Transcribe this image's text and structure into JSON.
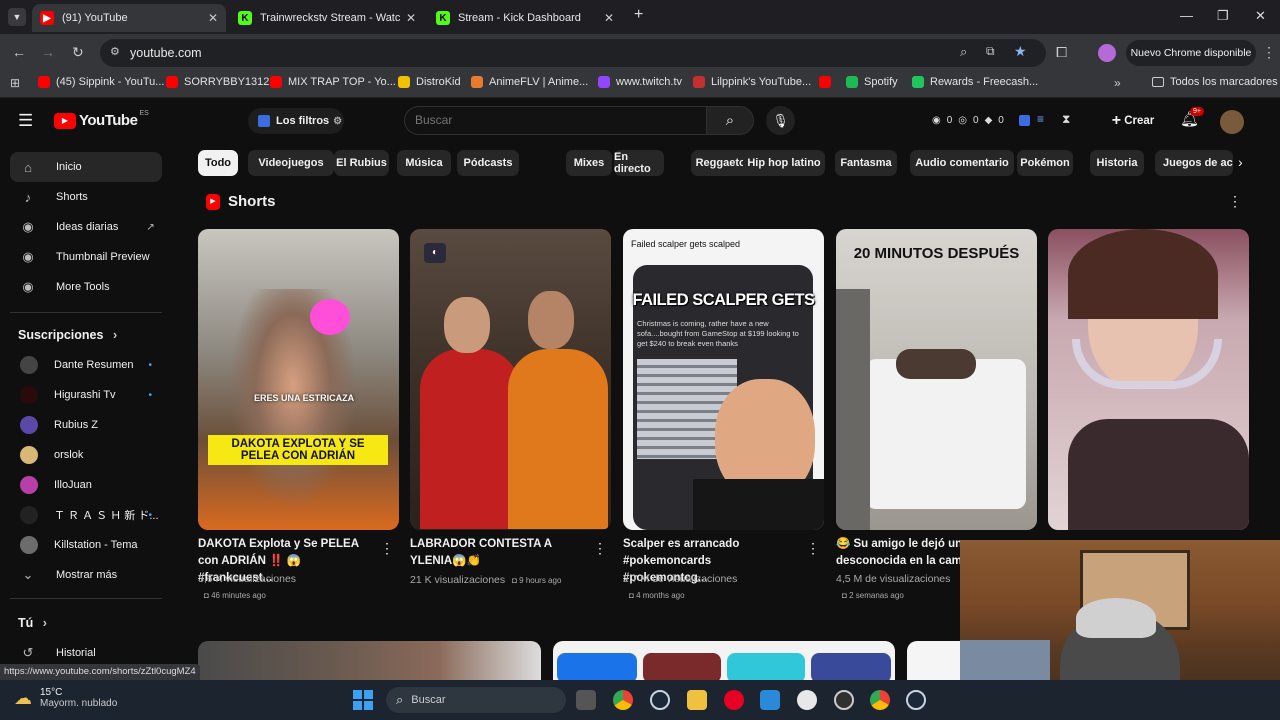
{
  "browser": {
    "tabs": [
      {
        "title": "(91) YouTube",
        "active": true,
        "favicon": "youtube-icon"
      },
      {
        "title": "Trainwreckstv Stream - Watch Li",
        "active": false,
        "favicon": "kick-icon"
      },
      {
        "title": "Stream - Kick Dashboard",
        "active": false,
        "favicon": "kick-icon"
      }
    ],
    "url": "youtube.com",
    "update_button": "Nuevo Chrome disponible",
    "bookmarks": [
      {
        "label": "(45) Sippink - YouTu...",
        "color": "#ff0000"
      },
      {
        "label": "SORRYBBY1312",
        "color": "#ff0000"
      },
      {
        "label": "MIX TRAP TOP - Yo...",
        "color": "#ff0000"
      },
      {
        "label": "DistroKid",
        "color": "#f2c200"
      },
      {
        "label": "AnimeFLV | Anime...",
        "color": "#e77b2f"
      },
      {
        "label": "www.twitch.tv",
        "color": "#9146ff"
      },
      {
        "label": "Lilppink's YouTube...",
        "color": "#c43030"
      },
      {
        "label": "",
        "color": "#ff0000"
      },
      {
        "label": "Spotify",
        "color": "#1db954"
      },
      {
        "label": "Rewards - Freecash...",
        "color": "#21c45d"
      }
    ],
    "all_bookmarks": "Todos los marcadores",
    "status_url": "https://www.youtube.com/shorts/zZtl0cugMZ4"
  },
  "youtube": {
    "logo": "YouTube",
    "region": "ES",
    "filters_button": "Los filtros",
    "search_placeholder": "Buscar",
    "counters": [
      "0",
      "0",
      "0"
    ],
    "create_label": "Crear",
    "notif_badge": "9+",
    "chips": [
      "Todo",
      "Videojuegos",
      "El Rubius",
      "Música",
      "Pódcasts",
      "Mixes",
      "En directo",
      "Reggaeton",
      "Hip hop latino",
      "Fantasma",
      "Audio comentario",
      "Pokémon",
      "Historia",
      "Juegos de acci"
    ],
    "shorts_title": "Shorts",
    "accent": "#ff0000"
  },
  "sidebar": {
    "main": [
      {
        "label": "Inicio",
        "icon": "home-icon"
      },
      {
        "label": "Shorts",
        "icon": "shorts-icon"
      },
      {
        "label": "Ideas diarias",
        "icon": "extension-icon"
      },
      {
        "label": "Thumbnail Preview",
        "icon": "extension-icon"
      },
      {
        "label": "More Tools",
        "icon": "extension-icon"
      }
    ],
    "subs_header": "Suscripciones",
    "subs": [
      {
        "label": "Dante Resumen",
        "color": "#444"
      },
      {
        "label": "Higurashi Tv",
        "color": "#2a0a0a"
      },
      {
        "label": "Rubius Z",
        "color": "#5b48a8"
      },
      {
        "label": "orslok",
        "color": "#d9b777"
      },
      {
        "label": "IlloJuan",
        "color": "#b640a8"
      },
      {
        "label": "Ｔ Ｒ Ａ Ｓ Ｈ 新 ド...",
        "color": "#222"
      },
      {
        "label": "Killstation - Tema",
        "color": "#6c6c6c"
      }
    ],
    "show_more": "Mostrar más",
    "you_header": "Tú",
    "history": "Historial"
  },
  "shorts": [
    {
      "title1": "DAKOTA Explota y Se PELEA",
      "title2": "con ADRIÁN ‼️ 😱#frankcuest...",
      "views": "3,6 K visualizaciones",
      "age": "46 minutes ago",
      "overlay1": "ERES UNA ESTRICAZA",
      "overlay2": "DAKOTA EXPLOTA Y SE PELEA CON ADRIÁN"
    },
    {
      "title1": "LABRADOR CONTESTA A",
      "title2": "YLENIA😱👏",
      "views": "21 K visualizaciones",
      "age": "9 hours ago"
    },
    {
      "title1": "Scalper es arrancado",
      "title2": "#pokemoncards #pokemontcg...",
      "views": "2,7 M de visualizaciones",
      "age": "4 months ago",
      "overlay1": "Failed scalper gets scalped",
      "overlay2": "FAILED SCALPER GETS",
      "overlay3": "Christmas is coming, rather have a new sofa....bought from GameStop at $199 looking to get $240 to break even thanks"
    },
    {
      "title1": "😂 Su amigo le dejó un",
      "title2": "desconocida en la cam",
      "views": "4,5 M de visualizaciones",
      "age": "2 semanas ago",
      "overlay1": "20 MINUTOS DESPUÉS"
    },
    {
      "title1": "",
      "title2": "",
      "views": "",
      "age": ""
    }
  ],
  "weather": {
    "temp": "15°C",
    "desc": "Mayorm. nublado"
  },
  "taskbar": {
    "search": "Buscar"
  }
}
